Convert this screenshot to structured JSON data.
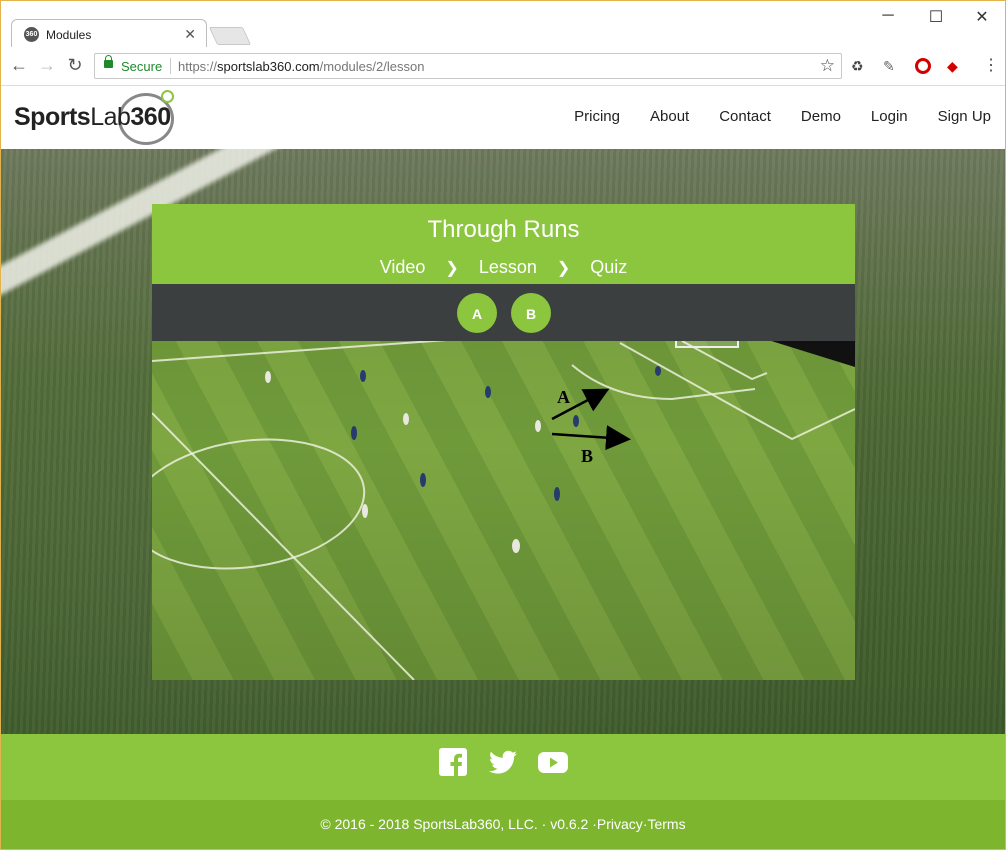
{
  "browser": {
    "tab_title": "Modules",
    "tab_favicon_text": "360",
    "secure_label": "Secure",
    "url_scheme": "https://",
    "url_host": "sportslab360.com",
    "url_path": "/modules/2/lesson"
  },
  "site": {
    "logo_bold": "Sports",
    "logo_light": "Lab",
    "logo_number": "360",
    "nav": [
      "Pricing",
      "About",
      "Contact",
      "Demo",
      "Login",
      "Sign Up"
    ]
  },
  "lesson": {
    "title": "Through Runs",
    "steps": [
      "Video",
      "Lesson",
      "Quiz"
    ],
    "options": [
      "A",
      "B"
    ],
    "diagram_labels": [
      "A",
      "B"
    ]
  },
  "footer": {
    "social_icons": [
      "facebook-icon",
      "twitter-icon",
      "youtube-icon"
    ],
    "copyright": "© 2016 - 2018 SportsLab360, LLC.",
    "version": "v0.6.2",
    "privacy": "Privacy",
    "terms": "Terms"
  },
  "colors": {
    "brand_green": "#8cc63f",
    "dark_bar": "#3c3f40"
  }
}
